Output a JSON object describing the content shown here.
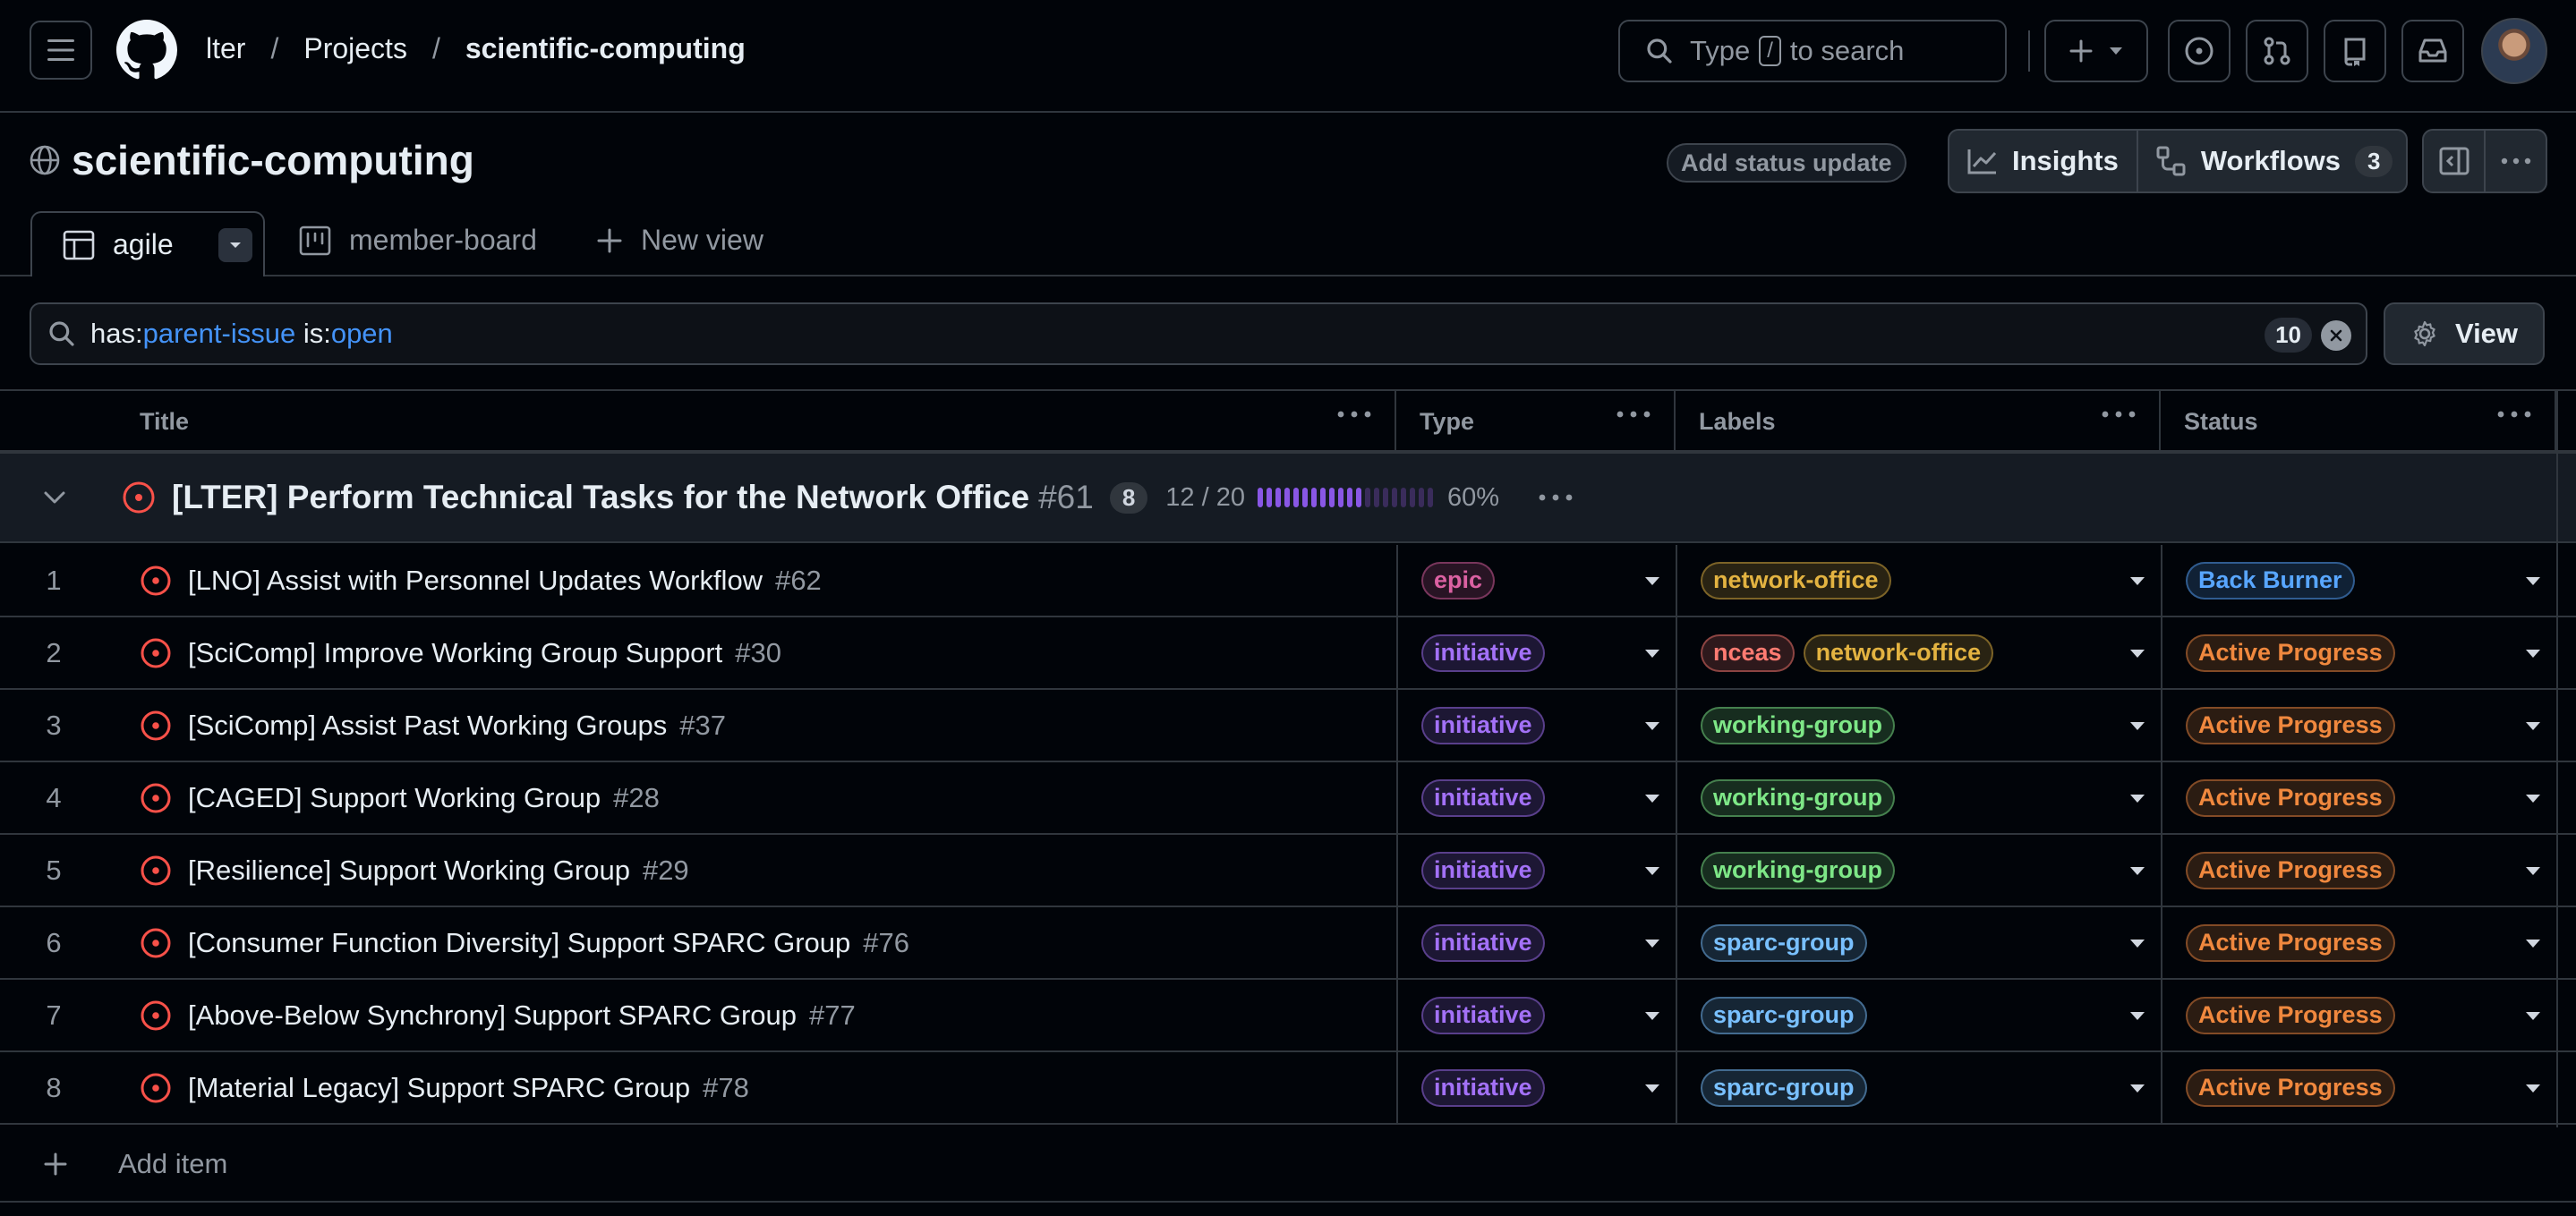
{
  "header": {
    "breadcrumbs": [
      "lter",
      "Projects",
      "scientific-computing"
    ],
    "search_prefix": "Type",
    "search_key": "/",
    "search_suffix": "to search"
  },
  "project": {
    "title": "scientific-computing",
    "add_status_update": "Add status update",
    "insights_label": "Insights",
    "workflows_label": "Workflows",
    "workflows_count": "3"
  },
  "tabs": {
    "active_label": "agile",
    "board_label": "member-board",
    "new_view_label": "New view"
  },
  "filter": {
    "part1_key": "has:",
    "part1_val": "parent-issue",
    "part2_key": "is:",
    "part2_val": "open",
    "count": "10",
    "view_label": "View"
  },
  "table": {
    "columns": [
      "Title",
      "Type",
      "Labels",
      "Status"
    ],
    "group": {
      "title": "[LTER] Perform Technical Tasks for the Network Office",
      "number": "#61",
      "count": "8",
      "progress_text": "12 / 20",
      "progress_fraction": 0.6,
      "percent": "60%"
    },
    "rows": [
      {
        "index": "1",
        "title": "[LNO] Assist with Personnel Updates Workflow",
        "number": "#62",
        "type": "epic",
        "labels": [
          "network-office"
        ],
        "status": "Back Burner"
      },
      {
        "index": "2",
        "title": "[SciComp] Improve Working Group Support",
        "number": "#30",
        "type": "initiative",
        "labels": [
          "nceas",
          "network-office"
        ],
        "status": "Active Progress"
      },
      {
        "index": "3",
        "title": "[SciComp] Assist Past Working Groups",
        "number": "#37",
        "type": "initiative",
        "labels": [
          "working-group"
        ],
        "status": "Active Progress"
      },
      {
        "index": "4",
        "title": "[CAGED] Support Working Group",
        "number": "#28",
        "type": "initiative",
        "labels": [
          "working-group"
        ],
        "status": "Active Progress"
      },
      {
        "index": "5",
        "title": "[Resilience] Support Working Group",
        "number": "#29",
        "type": "initiative",
        "labels": [
          "working-group"
        ],
        "status": "Active Progress"
      },
      {
        "index": "6",
        "title": "[Consumer Function Diversity] Support SPARC Group",
        "number": "#76",
        "type": "initiative",
        "labels": [
          "sparc-group"
        ],
        "status": "Active Progress"
      },
      {
        "index": "7",
        "title": "[Above-Below Synchrony] Support SPARC Group",
        "number": "#77",
        "type": "initiative",
        "labels": [
          "sparc-group"
        ],
        "status": "Active Progress"
      },
      {
        "index": "8",
        "title": "[Material Legacy] Support SPARC Group",
        "number": "#78",
        "type": "initiative",
        "labels": [
          "sparc-group"
        ],
        "status": "Active Progress"
      }
    ],
    "add_item_label": "Add item"
  },
  "colors": {
    "open_issue": "#f85149",
    "epic": "#db61a2",
    "initiative": "#a371f7",
    "network-office": "#e3b341",
    "nceas": "#ff7b72",
    "working-group": "#7ee787",
    "sparc-group": "#79c0ff",
    "Back Burner": "#58a6ff",
    "Active Progress": "#f0883e"
  }
}
